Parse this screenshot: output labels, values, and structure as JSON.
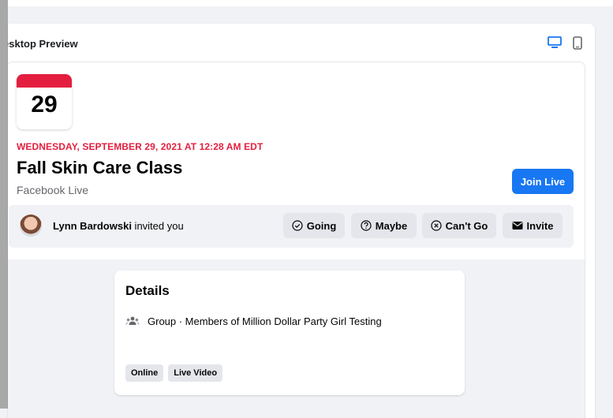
{
  "preview": {
    "title": "esktop Preview",
    "icons": {
      "desktop": "desktop-icon",
      "mobile": "mobile-phone-icon"
    }
  },
  "event": {
    "day": "29",
    "date_line": "WEDNESDAY, SEPTEMBER 29, 2021 AT 12:28 AM EDT",
    "name": "Fall Skin Care Class",
    "subtitle": "Facebook Live",
    "join_label": "Join Live"
  },
  "invite": {
    "inviter": "Lynn Bardowski",
    "text": " invited you",
    "buttons": [
      {
        "label": "Going",
        "icon": "check-circle-icon"
      },
      {
        "label": "Maybe",
        "icon": "question-circle-icon"
      },
      {
        "label": "Can't Go",
        "icon": "x-circle-icon"
      },
      {
        "label": "Invite",
        "icon": "envelope-icon"
      }
    ]
  },
  "details": {
    "title": "Details",
    "group_line": "Group · Members of Million Dollar Party Girl Testing",
    "tags": [
      "Online",
      "Live Video"
    ]
  },
  "colors": {
    "accent_blue": "#1877f2",
    "date_red": "#e41e3f",
    "background": "#f0f2f5",
    "button_gray": "#e4e6eb"
  }
}
